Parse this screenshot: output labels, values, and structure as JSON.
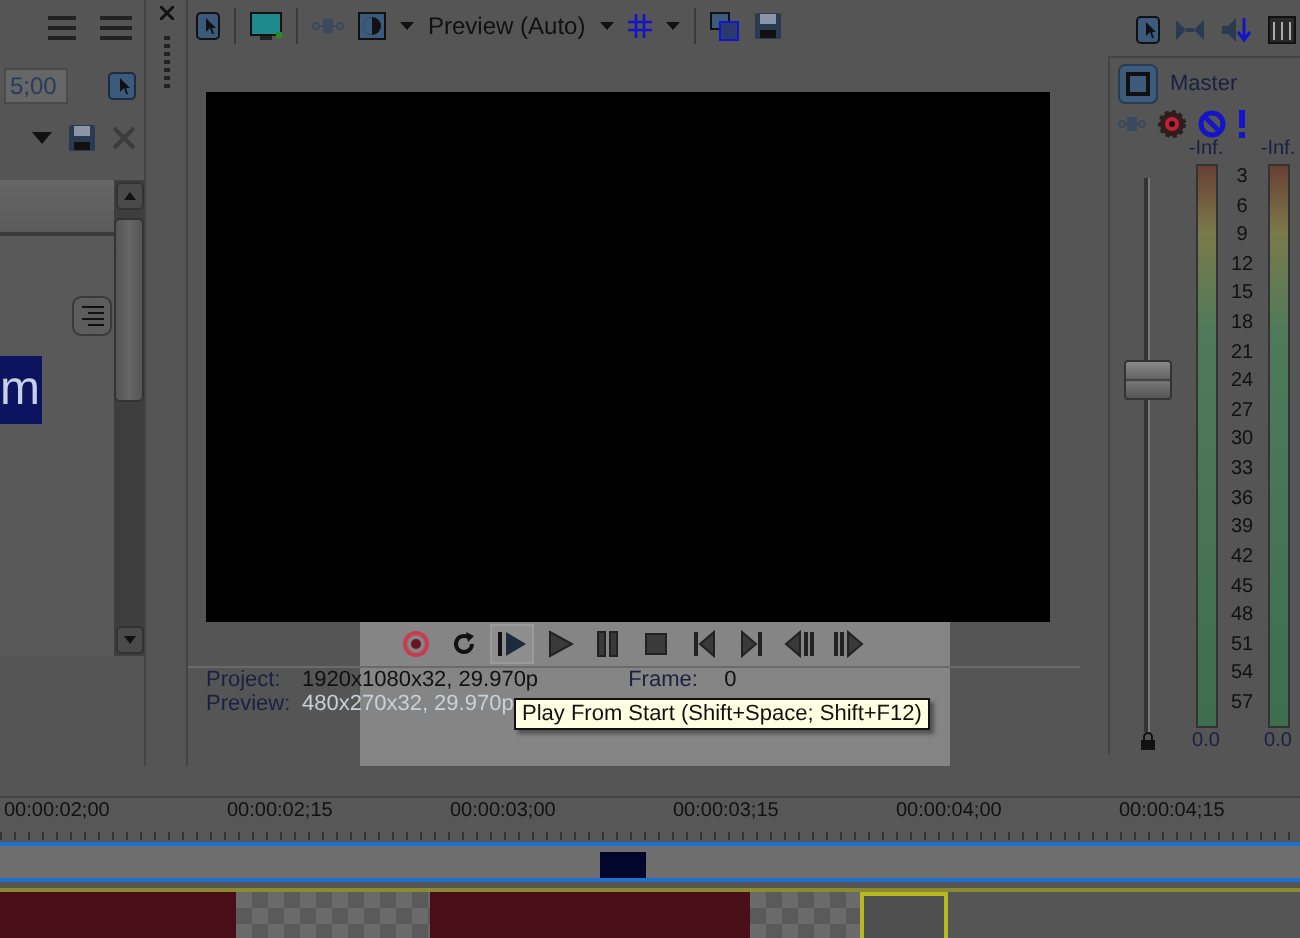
{
  "left_panel": {
    "time_field": {
      "value": "5;00"
    },
    "selected_text": "m"
  },
  "preview_toolbar": {
    "quality": "Preview (Auto)"
  },
  "transport": [
    {
      "kind": "record",
      "hovered": false
    },
    {
      "kind": "loop",
      "hovered": false
    },
    {
      "kind": "play-start",
      "hovered": true
    },
    {
      "kind": "play",
      "hovered": false
    },
    {
      "kind": "pause",
      "hovered": false
    },
    {
      "kind": "stop",
      "hovered": false
    },
    {
      "kind": "prev",
      "hovered": false
    },
    {
      "kind": "next",
      "hovered": false
    },
    {
      "kind": "prev-frame",
      "hovered": false
    },
    {
      "kind": "next-frame",
      "hovered": false
    }
  ],
  "info": {
    "project_label": "Project:",
    "project_value": "1920x1080x32, 29.970p",
    "frame_label": "Frame:",
    "frame_value": "0",
    "preview_label": "Preview:",
    "preview_value": "480x270x32, 29.970p"
  },
  "tooltip": "Play From Start (Shift+Space; Shift+F12)",
  "mixer": {
    "title": "Master",
    "peaks": [
      "-Inf.",
      "-Inf."
    ],
    "scale": [
      "3",
      "6",
      "9",
      "12",
      "15",
      "18",
      "21",
      "24",
      "27",
      "30",
      "33",
      "36",
      "39",
      "42",
      "45",
      "48",
      "51",
      "54",
      "57"
    ],
    "readouts": [
      "0.0",
      "0.0"
    ],
    "fader": {
      "level": 0.64
    }
  },
  "timeline": {
    "ticks": [
      "00:00:02;00",
      "00:00:02;15",
      "00:00:03;00",
      "00:00:03;15",
      "00:00:04;00",
      "00:00:04;15"
    ]
  }
}
